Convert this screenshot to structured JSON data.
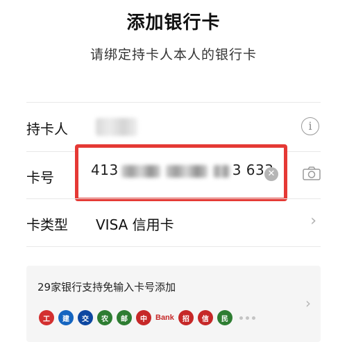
{
  "page": {
    "title": "添加银行卡",
    "subtitle": "请绑定持卡人本人的银行卡"
  },
  "form": {
    "holder_label": "持卡人",
    "card_number_label": "卡号",
    "card_number_prefix": "413",
    "card_number_suffix": "3 633",
    "card_type_label": "卡类型",
    "card_type_value": "VISA 信用卡"
  },
  "banks": {
    "title": "29家银行支持免输入卡号添加",
    "logos": [
      {
        "name": "icbc-logo",
        "color": "#d32f2f",
        "glyph": "工"
      },
      {
        "name": "ccb-logo",
        "color": "#1565c0",
        "glyph": "建"
      },
      {
        "name": "bocom-logo",
        "color": "#0d47a1",
        "glyph": "交"
      },
      {
        "name": "abc-logo",
        "color": "#2e7d32",
        "glyph": "农"
      },
      {
        "name": "psbc-logo",
        "color": "#2e7d32",
        "glyph": "邮"
      },
      {
        "name": "boc-logo",
        "color": "#c62828",
        "glyph": "中"
      },
      {
        "name": "bank-logo",
        "color": "#c62828",
        "glyph": "Bank"
      },
      {
        "name": "cmb-logo",
        "color": "#c62828",
        "glyph": "招"
      },
      {
        "name": "citic-logo",
        "color": "#c62828",
        "glyph": "信"
      },
      {
        "name": "cmbc-logo",
        "color": "#2e7d32",
        "glyph": "民"
      }
    ]
  },
  "colors": {
    "highlight": "#e53935",
    "divider": "#e8e8e8",
    "panel": "#f5f5f5"
  }
}
